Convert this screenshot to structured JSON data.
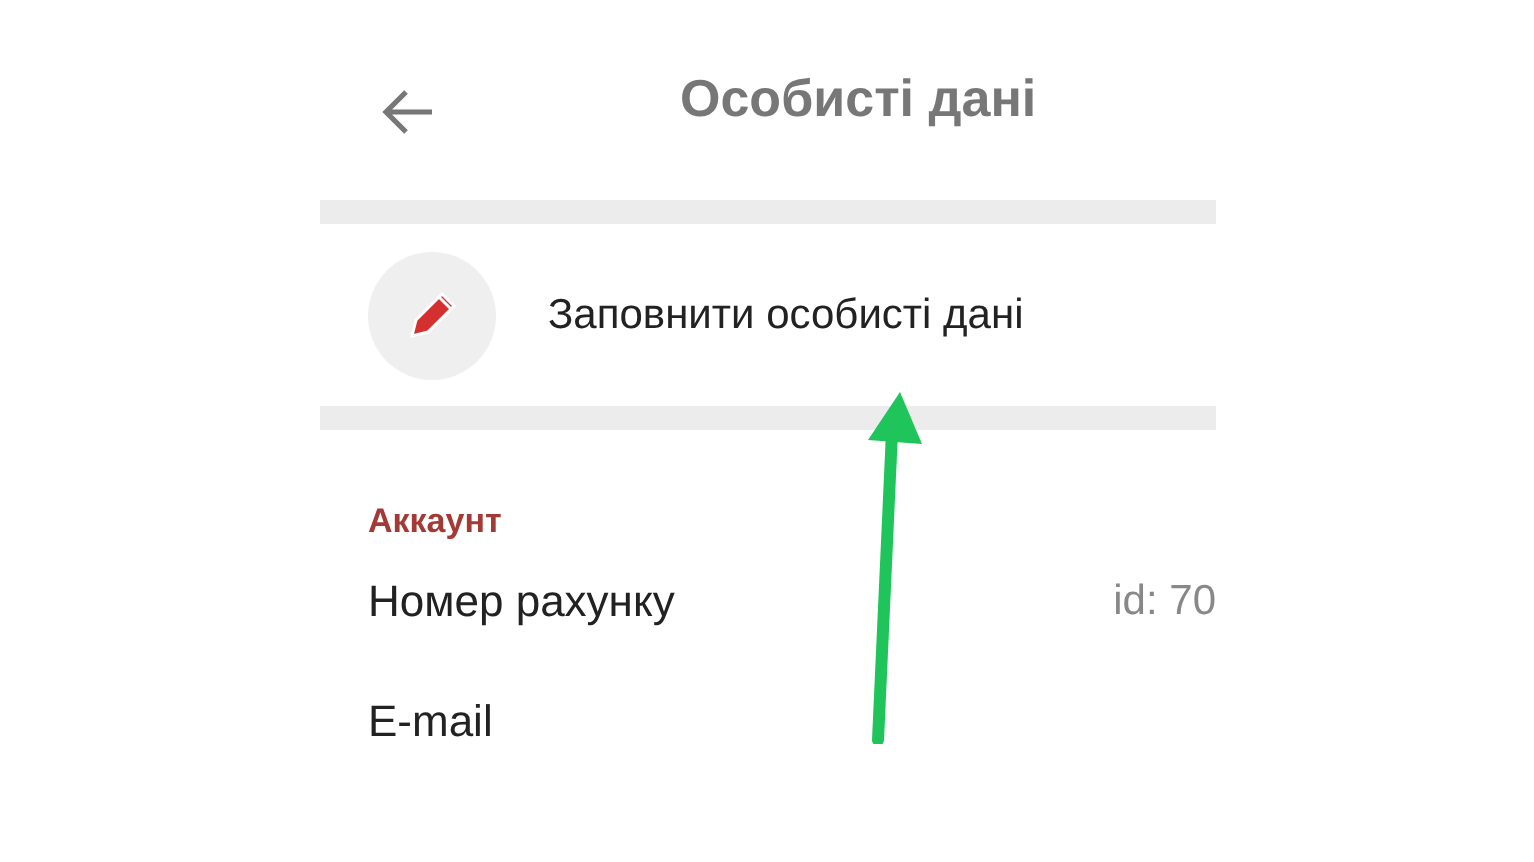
{
  "header": {
    "title": "Особисті дані"
  },
  "fill_action": {
    "label": "Заповнити особисті дані"
  },
  "section": {
    "title": "Аккаунт"
  },
  "rows": [
    {
      "label": "Номер рахунку",
      "value": "id: 70"
    },
    {
      "label": "E-mail"
    }
  ]
}
